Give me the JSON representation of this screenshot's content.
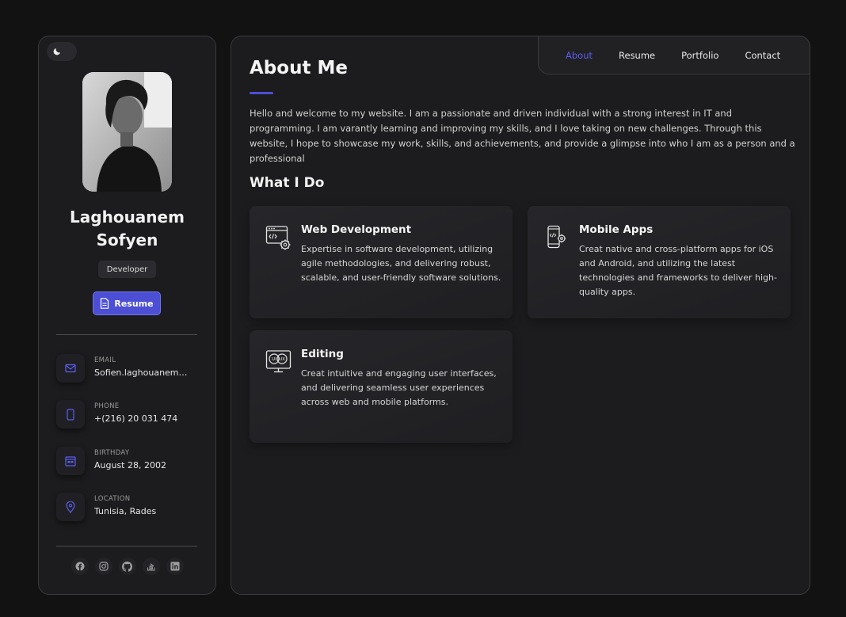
{
  "sidebar": {
    "name": "Laghouanem Sofyen",
    "role": "Developer",
    "resume_label": "Resume",
    "contacts": [
      {
        "label": "EMAIL",
        "value": "Sofien.laghouanem@g..."
      },
      {
        "label": "PHONE",
        "value": "+(216) 20 031 474"
      },
      {
        "label": "BIRTHDAY",
        "value": "August 28, 2002"
      },
      {
        "label": "LOCATION",
        "value": "Tunisia, Rades"
      }
    ],
    "socials": [
      "facebook-icon",
      "instagram-icon",
      "github-icon",
      "stackoverflow-icon",
      "linkedin-icon"
    ]
  },
  "nav": {
    "items": [
      "About",
      "Resume",
      "Portfolio",
      "Contact"
    ],
    "active": "About"
  },
  "main": {
    "title": "About Me",
    "intro": "Hello and welcome to my website. I am a passionate and driven individual with a strong interest in IT and programming. I am varantly learning and improving my skills, and I love taking on new challenges. Through this website, I hope to showcase my work, skills, and achievements, and provide a glimpse into who I am as a person and a professional",
    "what_i_do_title": "What I Do",
    "services": [
      {
        "title": "Web Development",
        "description": "Expertise in software development, utilizing agile methodologies, and delivering robust, scalable, and user-friendly software solutions.",
        "icon": "web-development-icon"
      },
      {
        "title": "Mobile Apps",
        "description": "Creat native and cross-platform apps for iOS and Android, and utilizing the latest technologies and frameworks to deliver high-quality apps.",
        "icon": "mobile-app-icon"
      },
      {
        "title": "Editing",
        "description": "Creat intuitive and engaging user interfaces, and delivering seamless user experiences across web and mobile platforms.",
        "icon": "ui-ux-icon"
      }
    ]
  },
  "colors": {
    "accent": "#4c4fd4",
    "background": "#121212",
    "card": "#1c1c1e"
  }
}
